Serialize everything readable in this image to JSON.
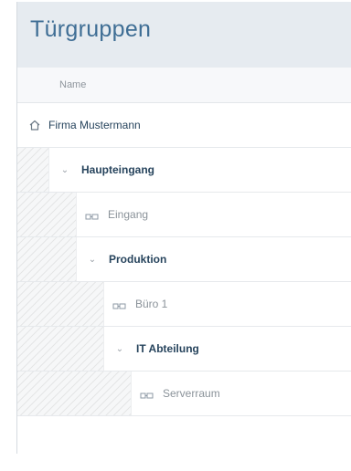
{
  "page": {
    "title": "Türgruppen",
    "column_name": "Name"
  },
  "tree": [
    {
      "label": "Firma Mustermann",
      "kind": "root",
      "icon": "home-icon",
      "level": 0
    },
    {
      "label": "Haupteingang",
      "kind": "group",
      "icon": "chevron-down-icon",
      "level": 1
    },
    {
      "label": "Eingang",
      "kind": "door",
      "icon": "door-icon",
      "level": 2
    },
    {
      "label": "Produktion",
      "kind": "group",
      "icon": "chevron-down-icon",
      "level": 2
    },
    {
      "label": "Büro 1",
      "kind": "door",
      "icon": "door-icon",
      "level": 3
    },
    {
      "label": "IT Abteilung",
      "kind": "group",
      "icon": "chevron-down-icon",
      "level": 3
    },
    {
      "label": "Serverraum",
      "kind": "door",
      "icon": "door-icon",
      "level": 4
    }
  ],
  "colors": {
    "title": "#3f6e95",
    "header_bg": "#e6ebf0",
    "group_text": "#27445d",
    "door_text": "#8a9299"
  }
}
